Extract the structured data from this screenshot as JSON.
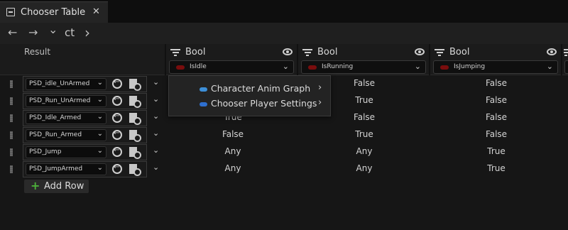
{
  "tab": {
    "title": "Chooser Table",
    "close": "✕"
  },
  "nav": {
    "back": "←",
    "forward": "→",
    "history": "⌄",
    "path": "ct",
    "next": "›"
  },
  "header": {
    "result_label": "Result",
    "columns": [
      {
        "type": "Bool",
        "param": "IsIdle"
      },
      {
        "type": "Bool",
        "param": "IsRunning"
      },
      {
        "type": "Bool",
        "param": "IsJumping"
      }
    ]
  },
  "rows": [
    {
      "asset": "PSD_idle_UnArmed",
      "values": [
        "",
        "False",
        "False"
      ]
    },
    {
      "asset": "PSD_Run_UnArmed",
      "values": [
        "",
        "True",
        "False"
      ]
    },
    {
      "asset": "PSD_Idle_Armed",
      "values": [
        "True",
        "False",
        "False"
      ]
    },
    {
      "asset": "PSD_Run_Armed",
      "values": [
        "False",
        "True",
        "False"
      ]
    },
    {
      "asset": "PSD_Jump",
      "values": [
        "Any",
        "Any",
        "True"
      ]
    },
    {
      "asset": "PSD_JumpArmed",
      "values": [
        "Any",
        "Any",
        "True"
      ]
    }
  ],
  "add_row_label": "Add Row",
  "menu": {
    "items": [
      {
        "label": "Character Anim Graph",
        "color": "#3d8fd8"
      },
      {
        "label": "Chooser Player Settings",
        "color": "#2e6fcf"
      }
    ]
  },
  "colors": {
    "bool_pill": "#7a0d0d",
    "add_plus": "#4caf3a"
  }
}
